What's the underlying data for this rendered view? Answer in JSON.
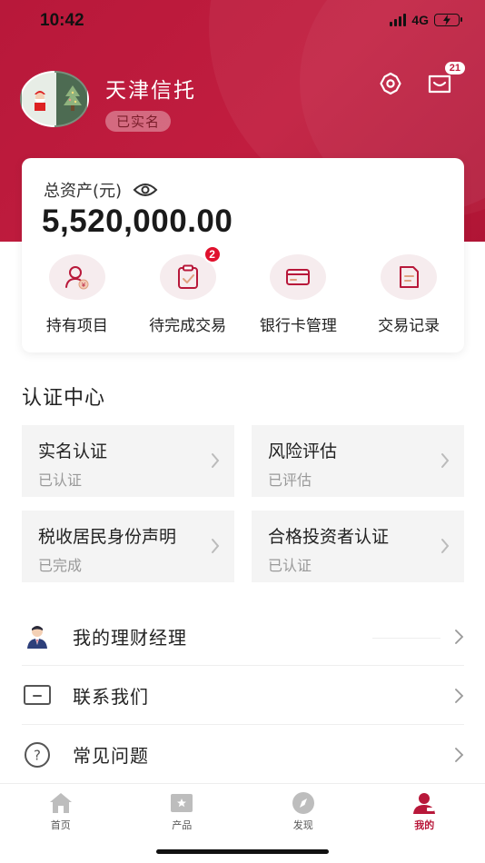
{
  "status": {
    "time": "10:42",
    "network": "4G"
  },
  "profile": {
    "name": "天津信托",
    "badge": "已实名"
  },
  "header": {
    "message_count": "21"
  },
  "assets": {
    "label": "总资产(元)",
    "value": "5,520,000.00",
    "quick_actions": [
      {
        "label": "持有项目",
        "icon": "holdings-icon"
      },
      {
        "label": "待完成交易",
        "icon": "pending-clipboard-icon",
        "badge": "2"
      },
      {
        "label": "银行卡管理",
        "icon": "bank-card-icon"
      },
      {
        "label": "交易记录",
        "icon": "records-icon"
      }
    ]
  },
  "cert_center": {
    "title": "认证中心",
    "items": [
      {
        "title": "实名认证",
        "status": "已认证"
      },
      {
        "title": "风险评估",
        "status": "已评估"
      },
      {
        "title": "税收居民身份声明",
        "status": "已完成"
      },
      {
        "title": "合格投资者认证",
        "status": "已认证"
      }
    ]
  },
  "menu": [
    {
      "label": "我的理财经理",
      "icon": "manager-avatar-icon"
    },
    {
      "label": "联系我们",
      "icon": "contact-icon"
    },
    {
      "label": "常见问题",
      "icon": "question-icon"
    }
  ],
  "tabbar": [
    {
      "label": "首页",
      "icon": "home-icon"
    },
    {
      "label": "产品",
      "icon": "product-icon"
    },
    {
      "label": "发现",
      "icon": "compass-icon"
    },
    {
      "label": "我的",
      "icon": "profile-icon",
      "active": true
    }
  ],
  "colors": {
    "brand": "#c11d3f",
    "badge": "#e0112d",
    "card_bg": "#f4f4f4"
  }
}
